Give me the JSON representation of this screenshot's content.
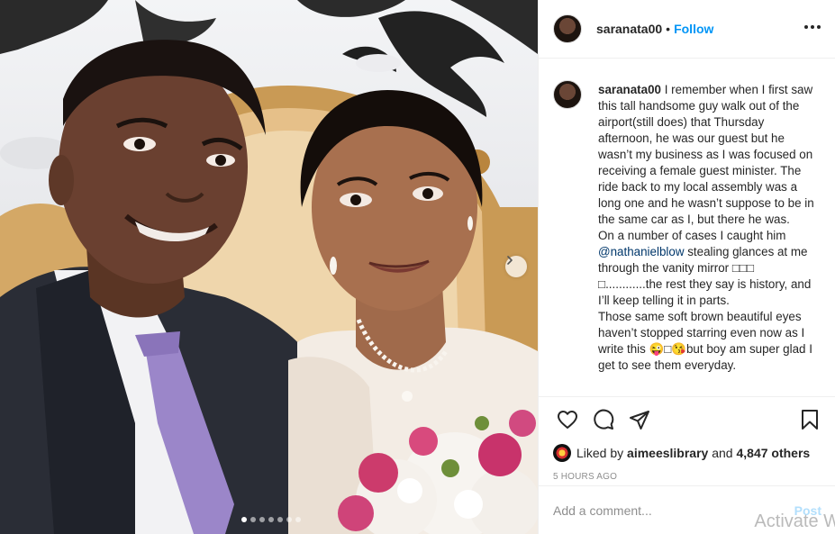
{
  "post": {
    "username": "saranata00",
    "follow_label": "Follow",
    "separator": "•",
    "more_icon": "more-options-icon",
    "carousel": {
      "total_slides": 7,
      "active_index": 0
    },
    "caption": {
      "author": "saranata00",
      "part1": "I remember when I first saw this tall handsome guy walk out of the airport(still does) that Thursday afternoon, he was our guest but he wasn’t my business as I was focused on receiving a female guest minister. The ride back to my local assembly was a long one and he wasn’t suppose to be in the same car as I, but there he was.",
      "part2_prefix": "On a number of cases I caught him",
      "mention": "@nathanielblow",
      "part2_suffix": "stealing glances at me through the vanity mirror □□□ □............the rest they say is history, and I’ll keep telling it in parts.",
      "part3": "Those same soft brown beautiful eyes haven’t stopped starring even now as I write this 😜□😘but boy am super glad I get to see them everyday."
    },
    "actions": {
      "like_icon": "heart-icon",
      "comment_icon": "comment-icon",
      "share_icon": "share-icon",
      "save_icon": "bookmark-icon"
    },
    "likes": {
      "prefix": "Liked by",
      "liker": "aimeeslibrary",
      "conjunction": "and",
      "others": "4,847 others"
    },
    "timestamp": "5 HOURS AGO",
    "comment_placeholder": "Add a comment...",
    "post_label": "Post"
  },
  "overlay": {
    "watermark": "Activate W"
  },
  "colors": {
    "accent": "#0095f6",
    "text": "#262626",
    "muted": "#8e8e8e",
    "post_disabled": "#b2dffc"
  }
}
